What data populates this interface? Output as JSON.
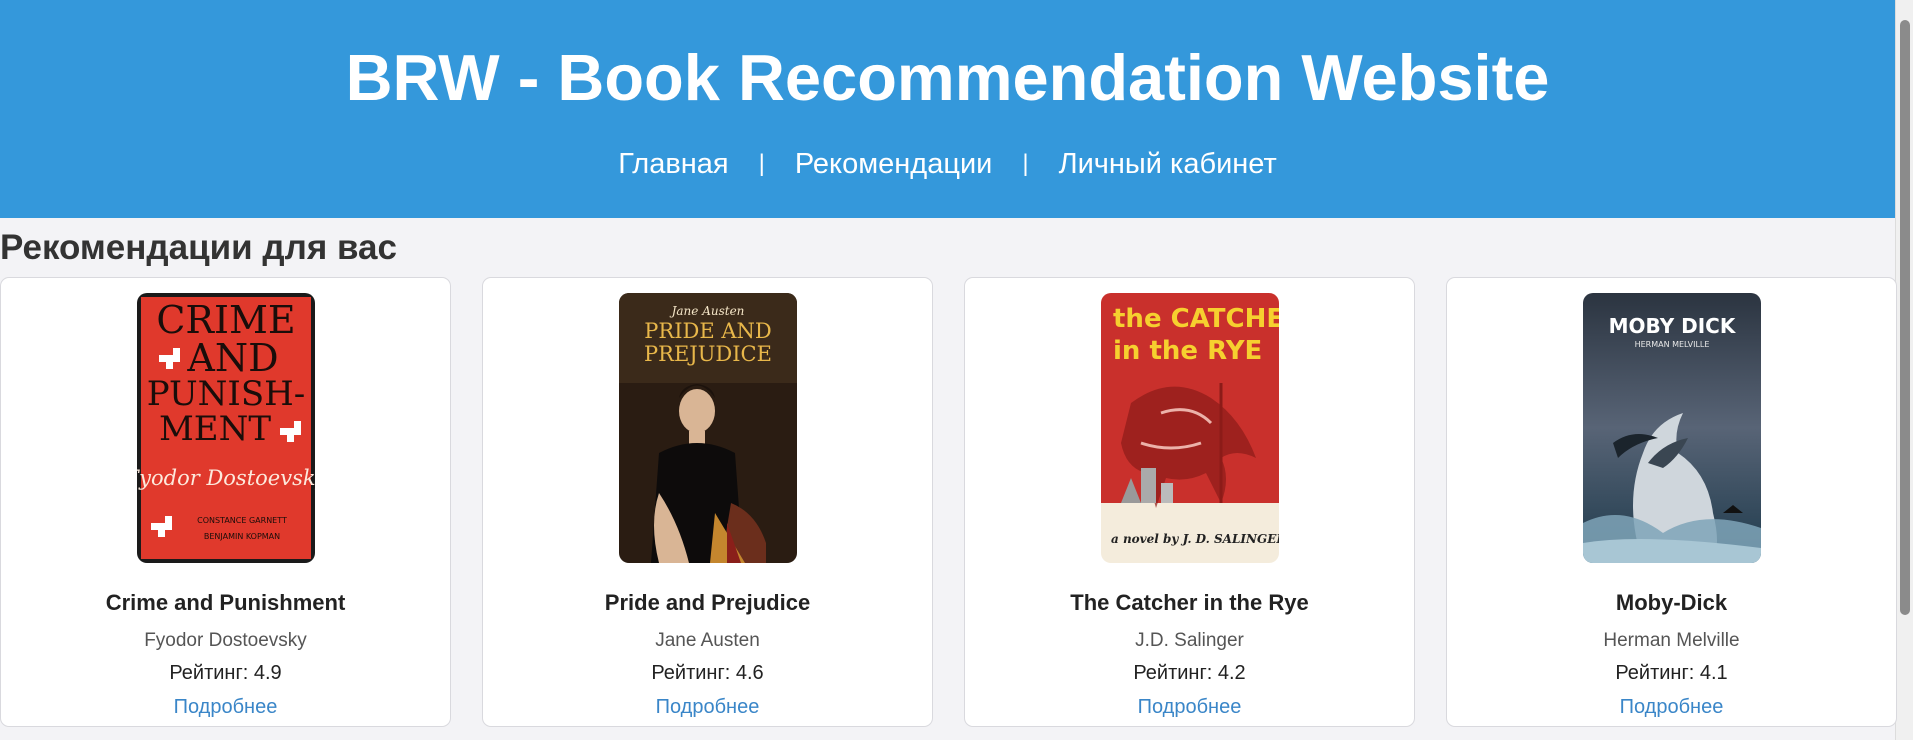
{
  "header": {
    "title": "BRW - Book Recommendation Website",
    "nav": [
      {
        "label": "Главная"
      },
      {
        "label": "Рекомендации"
      },
      {
        "label": "Личный кабинет"
      }
    ],
    "separator": "|"
  },
  "section": {
    "title": "Рекомендации для вас"
  },
  "books": [
    {
      "title": "Crime and Punishment",
      "author": "Fyodor Dostoevsky",
      "rating": "Рейтинг: 4.9",
      "link": "Подробнее",
      "cover": {
        "line1": "CRIME",
        "line2": "AND",
        "line3": "PUNISH-",
        "line4": "MENT",
        "author": "Fyodor Dostoevsky",
        "credit1": "CONSTANCE GARNETT",
        "credit2": "BENJAMIN KOPMAN"
      }
    },
    {
      "title": "Pride and Prejudice",
      "author": "Jane Austen",
      "rating": "Рейтинг: 4.6",
      "link": "Подробнее",
      "cover": {
        "author": "Jane Austen",
        "line1": "PRIDE AND",
        "line2": "PREJUDICE"
      }
    },
    {
      "title": "The Catcher in the Rye",
      "author": "J.D. Salinger",
      "rating": "Рейтинг: 4.2",
      "link": "Подробнее",
      "cover": {
        "line1": "the CATCHER",
        "line2": "in the RYE",
        "byline": "a novel by J. D. SALINGER"
      }
    },
    {
      "title": "Moby-Dick",
      "author": "Herman Melville",
      "rating": "Рейтинг: 4.1",
      "link": "Подробнее",
      "cover": {
        "title": "MOBY DICK",
        "author": "HERMAN MELVILLE"
      }
    }
  ],
  "colors": {
    "header_bg": "#3498db",
    "link": "#3a86c8",
    "page_bg": "#f3f3f6"
  }
}
